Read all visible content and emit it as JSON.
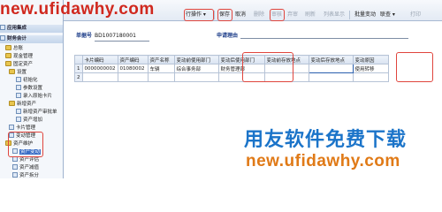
{
  "watermark": {
    "url": "new.ufidawhy.com",
    "promo": "用友软件免费下载"
  },
  "sidebar": {
    "items": [
      {
        "label": "应用集成",
        "kind": "head"
      },
      {
        "label": "财务会计",
        "kind": "head"
      },
      {
        "label": "总账",
        "kind": "node"
      },
      {
        "label": "现金管理",
        "kind": "node"
      },
      {
        "label": "固定资产",
        "kind": "folder"
      },
      {
        "label": "设置",
        "kind": "folder"
      },
      {
        "label": "初始化",
        "kind": "leaf"
      },
      {
        "label": "参数设置",
        "kind": "leaf"
      },
      {
        "label": "录入原始卡片",
        "kind": "leaf"
      },
      {
        "label": "新增资产",
        "kind": "folder"
      },
      {
        "label": "新增资产审批单",
        "kind": "leaf"
      },
      {
        "label": "资产增加",
        "kind": "leaf"
      },
      {
        "label": "卡片管理",
        "kind": "leaf"
      },
      {
        "label": "变动管理",
        "kind": "leaf"
      },
      {
        "label": "资产维护",
        "kind": "folder"
      },
      {
        "label": "资产变动",
        "kind": "leaf",
        "selected": true
      },
      {
        "label": "资产评估",
        "kind": "leaf"
      },
      {
        "label": "资产减值",
        "kind": "leaf"
      },
      {
        "label": "资产拆分",
        "kind": "leaf"
      }
    ]
  },
  "toolbar": {
    "buttons": [
      {
        "label": "行操作 ▾",
        "enabled": true
      },
      {
        "label": "保存",
        "enabled": true
      },
      {
        "label": "取消",
        "enabled": true
      },
      {
        "label": "删除",
        "enabled": false
      },
      {
        "label": "审核",
        "enabled": false
      },
      {
        "label": "弃审",
        "enabled": false
      },
      {
        "label": "刷新",
        "enabled": false
      },
      {
        "label": "列表显示",
        "enabled": false
      },
      {
        "label": "批量变动",
        "enabled": true
      },
      {
        "label": "联查 ▾",
        "enabled": true
      },
      {
        "label": "打印",
        "enabled": false
      }
    ]
  },
  "form": {
    "doc_no_label": "单据号",
    "doc_no_value": "BD1007180001",
    "reason_label": "申请理由"
  },
  "grid": {
    "columns": [
      "",
      "卡片编码",
      "资产编码",
      "资产名称",
      "变动前使用部门",
      "变动后使用部门",
      "变动前存放地点",
      "变动后存放地点",
      "变动原因"
    ],
    "rows": [
      [
        "1",
        "0000000002",
        "01080002",
        "车辆",
        "综合事务部",
        "财务管理部",
        "",
        "",
        "使用转移"
      ],
      [
        "2",
        "",
        "",
        "",
        "",
        "",
        "",
        "",
        ""
      ]
    ]
  }
}
